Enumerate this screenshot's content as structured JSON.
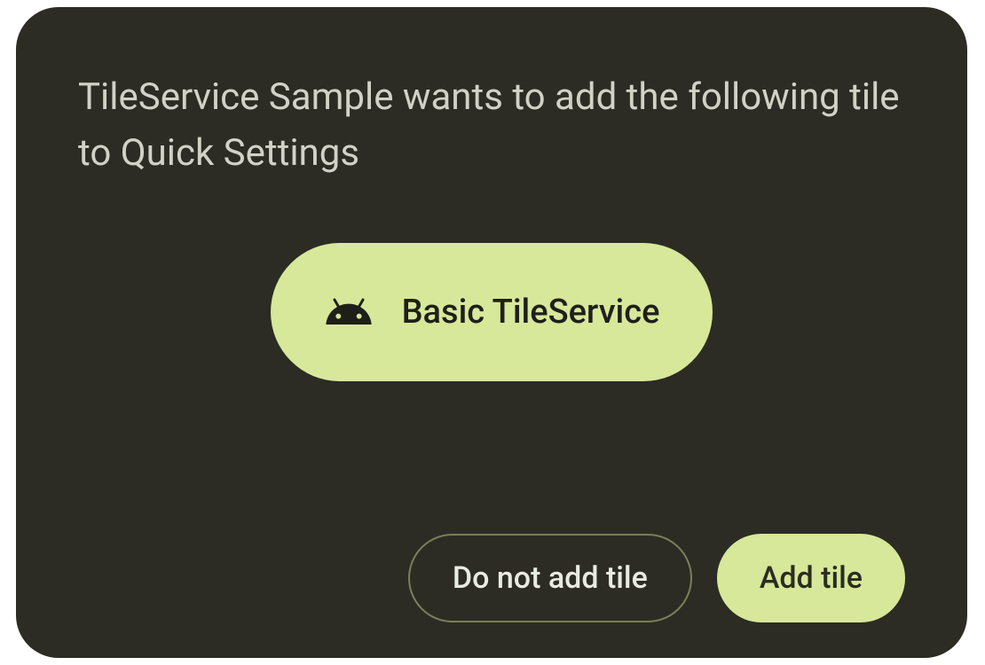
{
  "dialog": {
    "title": "TileService Sample wants to add the following tile to Quick Settings",
    "tile": {
      "icon": "android-icon",
      "label": "Basic TileService"
    },
    "buttons": {
      "deny_label": "Do not add tile",
      "confirm_label": "Add tile"
    }
  },
  "colors": {
    "card_background": "#2c2c24",
    "title_text": "#d0d2c6",
    "tile_background": "#d7e89a",
    "tile_foreground": "#1f1f1a",
    "button_outline": "#7a8058",
    "button_outline_text": "#e8ebdf",
    "button_filled_background": "#d7e89a",
    "button_filled_text": "#2a2d20"
  }
}
